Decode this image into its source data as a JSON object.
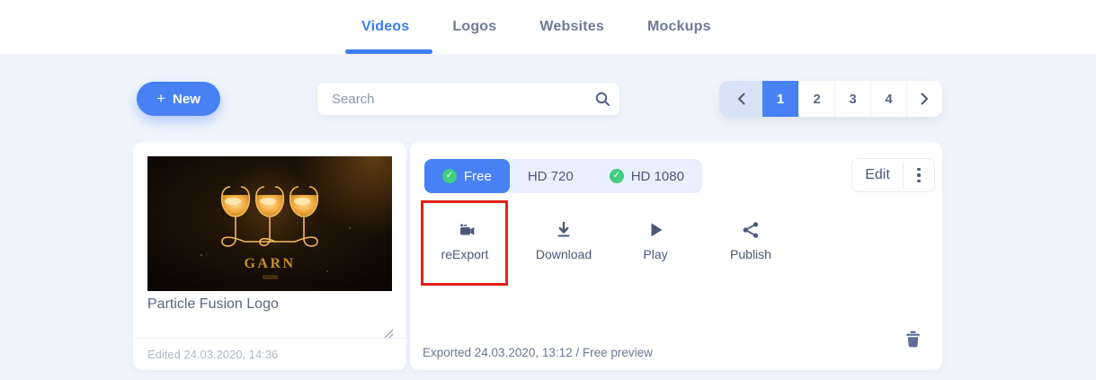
{
  "colors": {
    "accent": "#4781f4",
    "tab_active": "#3f7cf7",
    "success_green": "#43cd81",
    "highlight_red": "#e32119",
    "page_bg": "#f1f5fb"
  },
  "tabs": [
    {
      "label": "Videos",
      "active": true
    },
    {
      "label": "Logos",
      "active": false
    },
    {
      "label": "Websites",
      "active": false
    },
    {
      "label": "Mockups",
      "active": false
    }
  ],
  "toolbar": {
    "new_label": "New",
    "search_placeholder": "Search",
    "search_value": ""
  },
  "pagination": {
    "active_page": "1",
    "pages": [
      "1",
      "2",
      "3",
      "4"
    ],
    "prev_icon": "chevron-left-icon",
    "next_icon": "chevron-right-icon"
  },
  "video_card": {
    "title": "Particle Fusion Logo",
    "edited": "Edited 24.03.2020, 14:36",
    "thumbnail_text": "GARN",
    "quality_tabs": [
      {
        "label": "Free",
        "active": true,
        "check": true
      },
      {
        "label": "HD 720",
        "active": false,
        "check": false
      },
      {
        "label": "HD 1080",
        "active": false,
        "check": true
      }
    ],
    "edit_label": "Edit",
    "actions": [
      {
        "label": "reExport",
        "icon": "video-camera-icon",
        "highlighted": true
      },
      {
        "label": "Download",
        "icon": "download-icon",
        "highlighted": false
      },
      {
        "label": "Play",
        "icon": "play-icon",
        "highlighted": false
      },
      {
        "label": "Publish",
        "icon": "share-icon",
        "highlighted": false
      }
    ],
    "exported": "Exported 24.03.2020, 13:12 / Free preview"
  }
}
